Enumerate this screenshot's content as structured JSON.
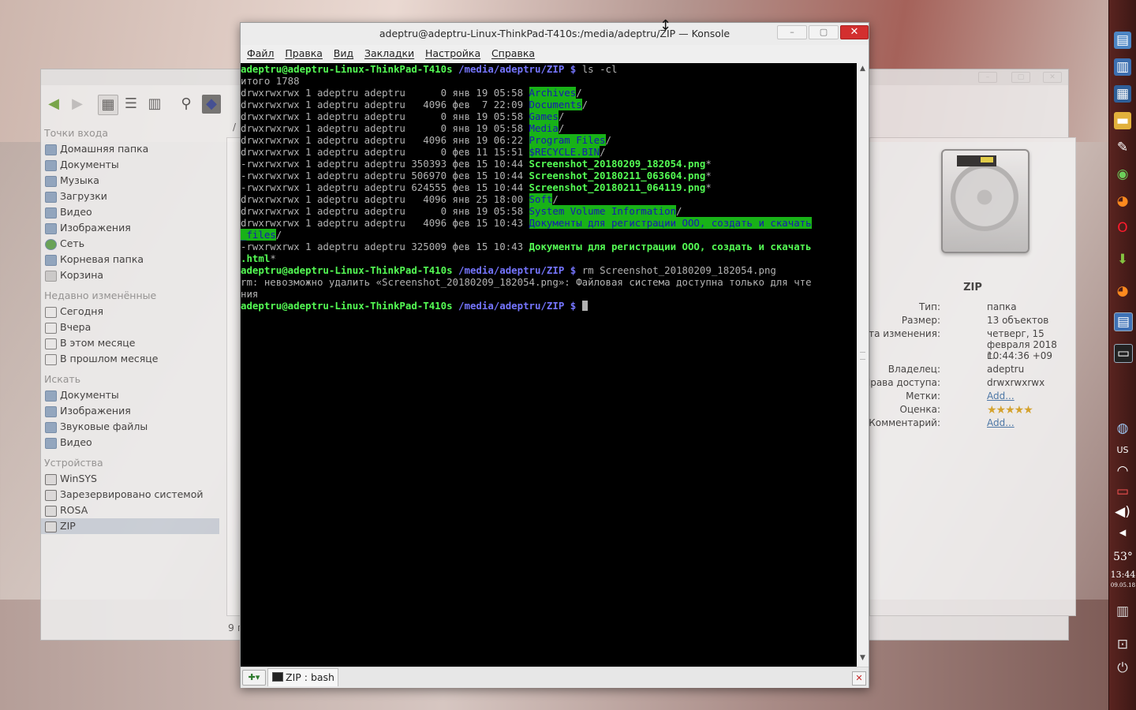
{
  "konsole": {
    "title": "adeptru@adeptru-Linux-ThinkPad-T410s:/media/adeptru/ZIP — Konsole",
    "menu": [
      "Файл",
      "Правка",
      "Вид",
      "Закладки",
      "Настройка",
      "Справка"
    ],
    "tab_label": "ZIP : bash",
    "prompt_user": "adeptru@adeptru-Linux-ThinkPad-T410s",
    "prompt_path": "/media/adeptru/ZIP",
    "prompt_sym": "$",
    "cmd1": "ls -cl",
    "total": "итого 1788",
    "listing": [
      {
        "perm": "drwxrwxrwx 1 adeptru adeptru      0 янв 19 05:58 ",
        "name": "Archives",
        "suffix": "/",
        "kind": "dir"
      },
      {
        "perm": "drwxrwxrwx 1 adeptru adeptru   4096 фев  7 22:09 ",
        "name": "Documents",
        "suffix": "/",
        "kind": "dir"
      },
      {
        "perm": "drwxrwxrwx 1 adeptru adeptru      0 янв 19 05:58 ",
        "name": "Games",
        "suffix": "/",
        "kind": "dir"
      },
      {
        "perm": "drwxrwxrwx 1 adeptru adeptru      0 янв 19 05:58 ",
        "name": "Media",
        "suffix": "/",
        "kind": "dir"
      },
      {
        "perm": "drwxrwxrwx 1 adeptru adeptru   4096 янв 19 06:22 ",
        "name": "Program Files",
        "suffix": "/",
        "kind": "dir"
      },
      {
        "perm": "drwxrwxrwx 1 adeptru adeptru      0 фев 11 15:51 ",
        "name": "$RECYCLE.BIN",
        "suffix": "/",
        "kind": "dir"
      },
      {
        "perm": "-rwxrwxrwx 1 adeptru adeptru 350393 фев 15 10:44 ",
        "name": "Screenshot_20180209_182054.png",
        "suffix": "*",
        "kind": "exe"
      },
      {
        "perm": "-rwxrwxrwx 1 adeptru adeptru 506970 фев 15 10:44 ",
        "name": "Screenshot_20180211_063604.png",
        "suffix": "*",
        "kind": "exe"
      },
      {
        "perm": "-rwxrwxrwx 1 adeptru adeptru 624555 фев 15 10:44 ",
        "name": "Screenshot_20180211_064119.png",
        "suffix": "*",
        "kind": "exe"
      },
      {
        "perm": "drwxrwxrwx 1 adeptru adeptru   4096 янв 25 18:00 ",
        "name": "Soft",
        "suffix": "/",
        "kind": "dir"
      },
      {
        "perm": "drwxrwxrwx 1 adeptru adeptru      0 янв 19 05:58 ",
        "name": "System Volume Information",
        "suffix": "/",
        "kind": "dir"
      }
    ],
    "wrap1_perm": "drwxrwxrwx 1 adeptru adeptru   4096 фев 15 10:43 ",
    "wrap1_name_a": "Документы для регистрации ООО, создать и скачать",
    "wrap1_name_b": "_files",
    "wrap1_suffix": "/",
    "wrap2_perm": "-rwxrwxrwx 1 adeptru adeptru 325009 фев 15 10:43 ",
    "wrap2_name_a": "Документы для регистрации ООО, создать и скачать",
    "wrap2_name_b": ".html",
    "wrap2_suffix": "*",
    "cmd2": "rm Screenshot_20180209_182054.png",
    "error_a": "rm: невозможно удалить «Screenshot_20180209_182054.png»: Файловая система доступна только для чте",
    "error_b": "ния"
  },
  "dolphin": {
    "places_head": "Точки входа",
    "places": [
      "Домашняя папка",
      "Документы",
      "Музыка",
      "Загрузки",
      "Видео",
      "Изображения",
      "Сеть",
      "Корневая папка",
      "Корзина"
    ],
    "recent_head": "Недавно изменённые",
    "recent": [
      "Сегодня",
      "Вчера",
      "В этом месяце",
      "В прошлом месяце"
    ],
    "search_head": "Искать",
    "search": [
      "Документы",
      "Изображения",
      "Звуковые файлы",
      "Видео"
    ],
    "devices_head": "Устройства",
    "devices": [
      "WinSYS",
      "Зарезервировано системой",
      "ROSA",
      "ZIP"
    ],
    "breadcrumb_slash": "/",
    "status_fragment": "9 п",
    "side_fragment": "es",
    "info": {
      "name": "ZIP",
      "type_k": "Тип:",
      "type_v": "папка",
      "size_k": "Размер:",
      "size_v": "13 объектов",
      "date_k": "Дата изменения:",
      "date_v1": "четверг, 15",
      "date_v2": "февраля 2018 г.",
      "date_v3": "10:44:36 +09",
      "owner_k": "Владелец:",
      "owner_v": "adeptru",
      "perm_k": "Права доступа:",
      "perm_v": "drwxrwxrwx",
      "tags_k": "Метки:",
      "tags_v": "Add...",
      "rating_k": "Оценка:",
      "rating_v": "★★★★★",
      "comment_k": "Комментарий:",
      "comment_v": "Add..."
    }
  },
  "panel": {
    "weather": "53°",
    "time": "13:44",
    "date": "09.05.18"
  }
}
